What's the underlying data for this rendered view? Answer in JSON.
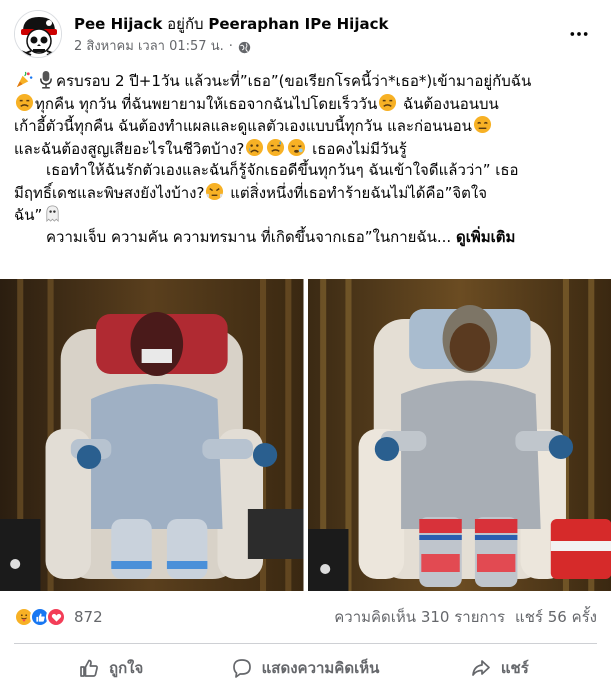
{
  "post": {
    "author": "Pee Hijack",
    "with_text": "อยู่กับ",
    "tagged": "Peeraphan IPe Hijack",
    "timestamp": "2 สิงหาคม เวลา 01:57 น.",
    "separator": "·",
    "privacy_icon": "globe-icon",
    "more_icon": "more-icon",
    "text": {
      "line1_a": "ครบรอบ 2 ปี+1วัน แล้วนะที่”เธอ”(ขอเรียกโรคนี้ว่า*เธอ*)เข้ามาอยู่กับฉัน",
      "line2_a": "ทุกคืน ทุกวัน ที่ฉันพยายามให้เธอจากฉันไปโดยเร็ววัน",
      "line2_b": " ฉันต้องนอนบน",
      "line3": "เก้าอี้ตัวนี้ทุกคืน ฉันต้องทำแผลและดูแลตัวเองแบบนี้ทุกวัน และก่อนนอน",
      "line4_a": "และฉันต้องสูญเสียอะไรในชีวิตบ้าง?",
      "line4_b": " เธอคงไม่มีวันรู้",
      "line5": "เธอทำให้ฉันรักตัวเองและฉันก็รู้จักเธอดีขึ้นทุกวันๆ ฉันเข้าใจดีแล้วว่า” เธอ",
      "line6_a": "มีฤทธิ์เดชและพิษสงยังไงบ้าง?",
      "line6_b": " แต่สิ่งหนึ่งที่เธอทำร้ายฉันไม่ได้คือ”จิตใจ",
      "line7": "ฉัน”",
      "line8": "ความเจ็บ ความคัน ความทรมาน ที่เกิดขึ้นจากเธอ”ในกายฉัน...",
      "see_more": "ดูเพิ่มเติม"
    }
  },
  "stats": {
    "reaction_count": "872",
    "comments": "ความคิดเห็น 310 รายการ",
    "shares": "แชร์ 56 ครั้ง"
  },
  "actions": {
    "like": "ถูกใจ",
    "comment": "แสดงความคิดเห็น",
    "share": "แชร์"
  },
  "colors": {
    "link_gray": "#65676b",
    "like_blue": "#1877f2",
    "love_red": "#f33e58",
    "care_yellow": "#f7b125"
  }
}
